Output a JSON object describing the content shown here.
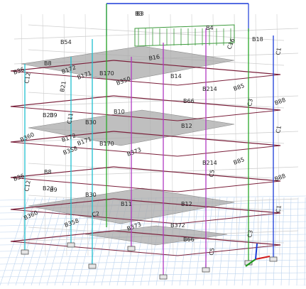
{
  "model_view": {
    "frame_colors": {
      "background": "#ffffff",
      "floor_plane": "#a9a9a9",
      "beam_dark": "#7a1f3a",
      "column_cyan": "#1fbfcf",
      "column_magenta": "#b03ac2",
      "column_green": "#2aa82a",
      "column_blue": "#1b3cd9",
      "wire_light": "#cfcfcf",
      "base_grid": "#bcd3ee",
      "stair_green": "#3c9a3c"
    },
    "labels": [
      "B3",
      "B4",
      "B18",
      "B54",
      "C1",
      "C16",
      "B8",
      "B172",
      "B171",
      "B170",
      "B350",
      "B14",
      "B85",
      "B214",
      "C12",
      "B36",
      "B30",
      "B9",
      "C11",
      "B10",
      "B12",
      "B66",
      "C3",
      "B88",
      "B23",
      "B360",
      "B358",
      "B373",
      "B372",
      "C5",
      "C2",
      "B11",
      "B16",
      "B21"
    ],
    "axis_icon": [
      "x-axis-arrow",
      "y-axis-arrow",
      "z-axis-arrow"
    ]
  }
}
